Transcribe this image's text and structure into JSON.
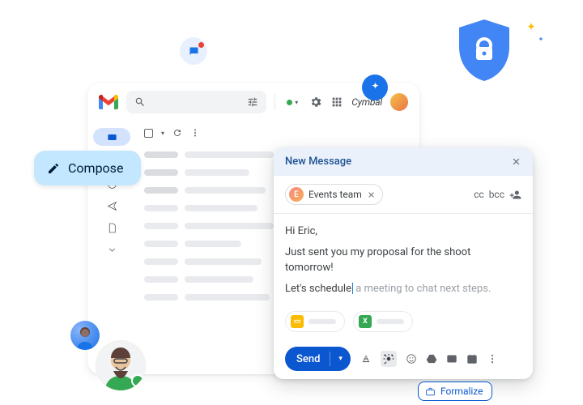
{
  "header": {
    "brand": "Cymbal"
  },
  "compose_button": {
    "label": "Compose"
  },
  "compose": {
    "window_title": "New Message",
    "recipient": {
      "initial": "E",
      "name": "Events team"
    },
    "cc_label": "cc",
    "bcc_label": "bcc",
    "greeting": "Hi Eric,",
    "body_line": "Just sent you my proposal for the shoot tomorrow!",
    "typed_prefix": "Let's schedule",
    "suggestion_suffix": " a meeting to chat next steps.",
    "send_label": "Send"
  },
  "formalize": {
    "label": "Formalize"
  },
  "icons": {
    "search": "search-icon",
    "tune": "tune-icon",
    "settings": "gear-icon",
    "apps": "apps-grid-icon",
    "close": "close-icon",
    "pencil": "pencil-icon"
  }
}
